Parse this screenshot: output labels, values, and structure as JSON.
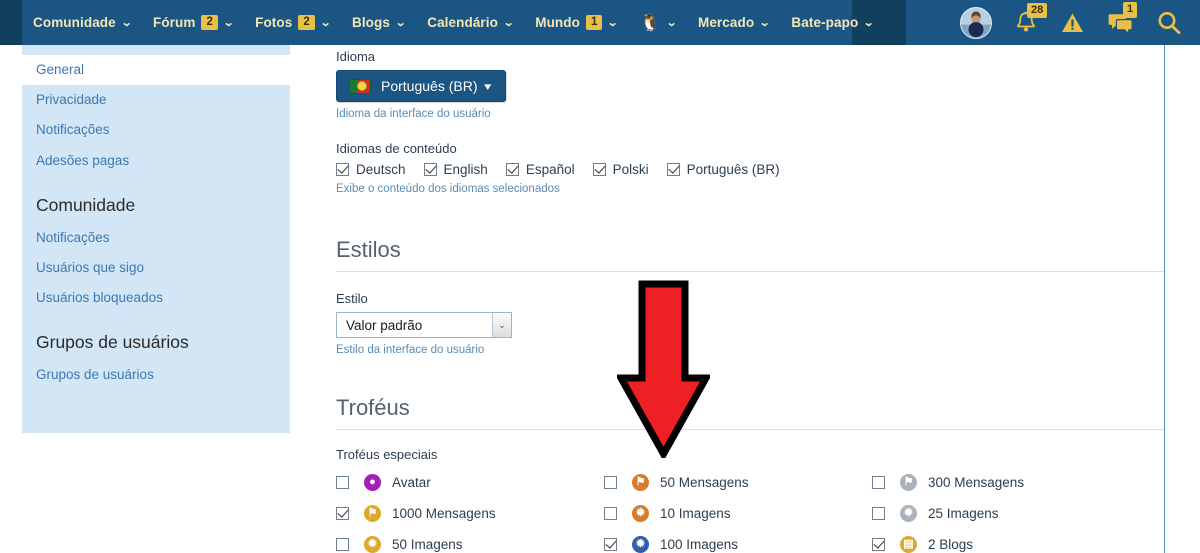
{
  "colors": {
    "navbar_bg": "#1a5584",
    "navbar_dark": "#11405f",
    "nav_text": "#f3e6b8",
    "badge_bg": "#e8c049",
    "sidebar_bg": "#d3e6f6",
    "link_blue": "#3c78b4",
    "arrow_red": "#ee2024",
    "rule_blue": "#cfe0ee"
  },
  "navbar": {
    "items": [
      {
        "label": "Comunidade",
        "badge": null,
        "caret": true,
        "icon": null
      },
      {
        "label": "Fórum",
        "badge": "2",
        "caret": true,
        "icon": null
      },
      {
        "label": "Fotos",
        "badge": "2",
        "caret": true,
        "icon": null
      },
      {
        "label": "Blogs",
        "badge": null,
        "caret": true,
        "icon": null
      },
      {
        "label": "Calendário",
        "badge": null,
        "caret": true,
        "icon": null
      },
      {
        "label": "Mundo",
        "badge": "1",
        "caret": true,
        "icon": null
      },
      {
        "label": "",
        "badge": null,
        "caret": true,
        "icon": "penguin-icon"
      },
      {
        "label": "Mercado",
        "badge": null,
        "caret": true,
        "icon": null
      },
      {
        "label": "Bate-papo",
        "badge": null,
        "caret": true,
        "icon": null
      }
    ],
    "caret_glyph": "⌄",
    "penguin_glyph": "🐧",
    "right": {
      "avatar_name": "user-avatar",
      "bell_badge": "28",
      "alerts_icon": "warning-triangle-icon",
      "messages_badge": "1",
      "search_icon": "search-icon"
    }
  },
  "sidebar": {
    "groups": [
      {
        "heading": null,
        "items": [
          {
            "label": "General",
            "active": true
          },
          {
            "label": "Privacidade",
            "active": false
          },
          {
            "label": "Notificações",
            "active": false
          },
          {
            "label": "Adesões pagas",
            "active": false
          }
        ]
      },
      {
        "heading": "Comunidade",
        "items": [
          {
            "label": "Notificações",
            "active": false
          },
          {
            "label": "Usuários que sigo",
            "active": false
          },
          {
            "label": "Usuários bloqueados",
            "active": false
          }
        ]
      },
      {
        "heading": "Grupos de usuários",
        "items": [
          {
            "label": "Grupos de usuários",
            "active": false
          }
        ]
      }
    ]
  },
  "main": {
    "language": {
      "label": "Idioma",
      "button_text": "Português (BR)",
      "flag": "brazil-portugal-flag-icon",
      "caret_glyph": "▾",
      "help": "Idioma da interface do usuário"
    },
    "content_languages": {
      "label": "Idiomas de conteúdo",
      "help": "Exibe o conteúdo dos idiomas selecionados",
      "options": [
        {
          "label": "Deutsch",
          "checked": true
        },
        {
          "label": "English",
          "checked": true
        },
        {
          "label": "Español",
          "checked": true
        },
        {
          "label": "Polski",
          "checked": true
        },
        {
          "label": "Português (BR)",
          "checked": true
        }
      ]
    },
    "styles": {
      "heading": "Estilos",
      "field_label": "Estilo",
      "selected_value": "Valor padrão",
      "arrow_glyph": "⌄",
      "help": "Estilo da interface do usuário"
    },
    "trophies": {
      "heading": "Troféus",
      "subheading": "Troféus especiais",
      "items": [
        {
          "label": "Avatar",
          "checked": false,
          "icon": "trophy-avatar-icon",
          "color": "#a320b8",
          "glyph": "●"
        },
        {
          "label": "50 Mensagens",
          "checked": false,
          "icon": "trophy-bronze-icon",
          "color": "#d77c2b",
          "glyph": "⚑"
        },
        {
          "label": "300 Mensagens",
          "checked": false,
          "icon": "trophy-silver-icon",
          "color": "#a8b3bd",
          "glyph": "⚑"
        },
        {
          "label": "1000 Mensagens",
          "checked": true,
          "icon": "trophy-gold-icon",
          "color": "#e0a92b",
          "glyph": "⚑"
        },
        {
          "label": "10 Imagens",
          "checked": false,
          "icon": "trophy-bronze2-icon",
          "color": "#d77c2b",
          "glyph": "✹"
        },
        {
          "label": "25 Imagens",
          "checked": false,
          "icon": "trophy-silver2-icon",
          "color": "#a8b3bd",
          "glyph": "✹"
        },
        {
          "label": "50 Imagens",
          "checked": false,
          "icon": "trophy-gold2-icon",
          "color": "#e0a92b",
          "glyph": "✹"
        },
        {
          "label": "100 Imagens",
          "checked": true,
          "icon": "trophy-blue-icon",
          "color": "#2f5fb0",
          "glyph": "✹"
        },
        {
          "label": "2 Blogs",
          "checked": true,
          "icon": "trophy-blog-icon",
          "color": "#e0a92b",
          "glyph": "▤"
        }
      ]
    }
  },
  "annotation": {
    "arrow": "red-down-arrow-pointing-to-trofeus"
  }
}
